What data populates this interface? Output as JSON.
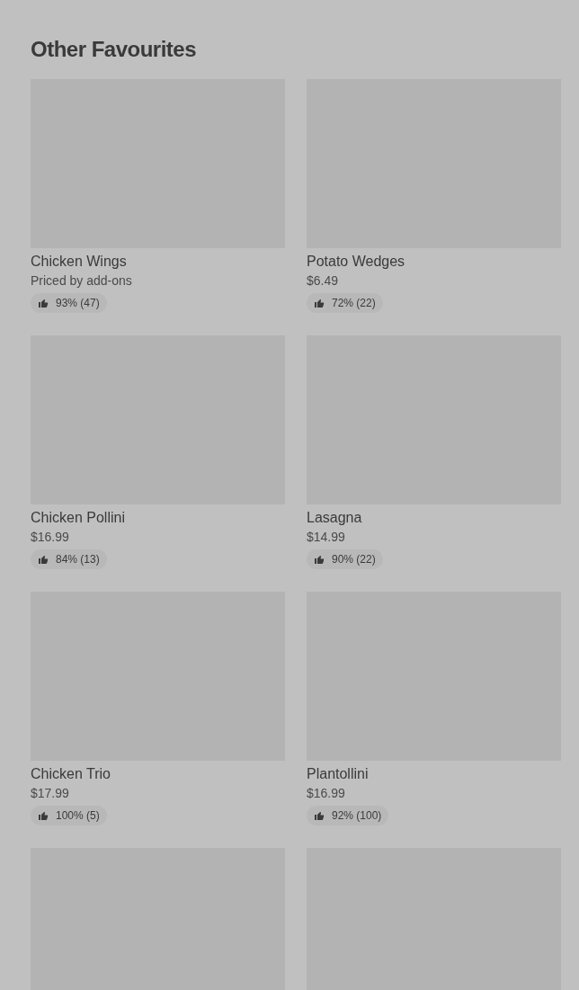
{
  "section": {
    "title": "Other Favourites"
  },
  "items": [
    {
      "kind": "dish",
      "name": "Chicken Wings",
      "price": "Priced by add-ons",
      "rating": "93% (47)"
    },
    {
      "kind": "dish",
      "name": "Potato Wedges",
      "price": "$6.49",
      "rating": "72% (22)"
    },
    {
      "kind": "dish",
      "name": "Chicken Pollini",
      "price": "$16.99",
      "rating": "84% (13)"
    },
    {
      "kind": "dish",
      "name": "Lasagna",
      "price": "$14.99",
      "rating": "90% (22)"
    },
    {
      "kind": "dish",
      "name": "Chicken Trio",
      "price": "$17.99",
      "rating": "100% (5)"
    },
    {
      "kind": "dish",
      "name": "Plantollini",
      "price": "$16.99",
      "rating": "92% (100)"
    },
    {
      "kind": "cut_off"
    },
    {
      "kind": "cut_off"
    }
  ]
}
